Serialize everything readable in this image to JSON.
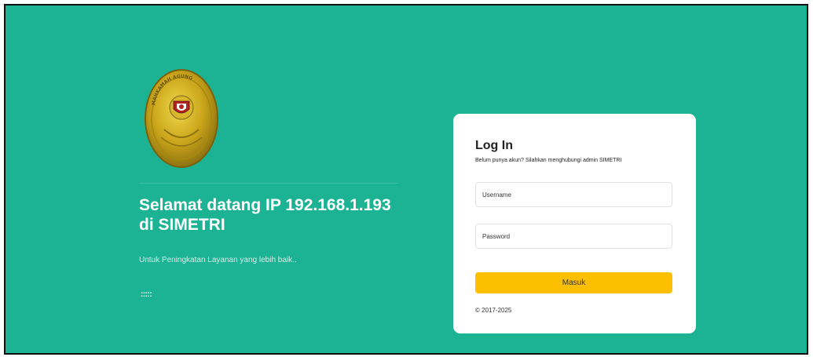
{
  "left": {
    "logo_icon": "mahkamah-agung-emblem",
    "logo_text": "MAHKAMAH AGUNG",
    "welcome_title": "Selamat datang IP 192.168.1.193 di SIMETRI",
    "subtitle": "Untuk Peningkatan Layanan yang lebih baik..",
    "dots": ":::::"
  },
  "login": {
    "title": "Log In",
    "description": "Belum punya akun? Silahkan menghubungi admin SIMETRI",
    "username_placeholder": "Username",
    "password_placeholder": "Password",
    "submit_label": "Masuk",
    "copyright": "© 2017-2025"
  },
  "colors": {
    "background": "#1cb394",
    "button": "#fcc000",
    "card": "#ffffff"
  }
}
